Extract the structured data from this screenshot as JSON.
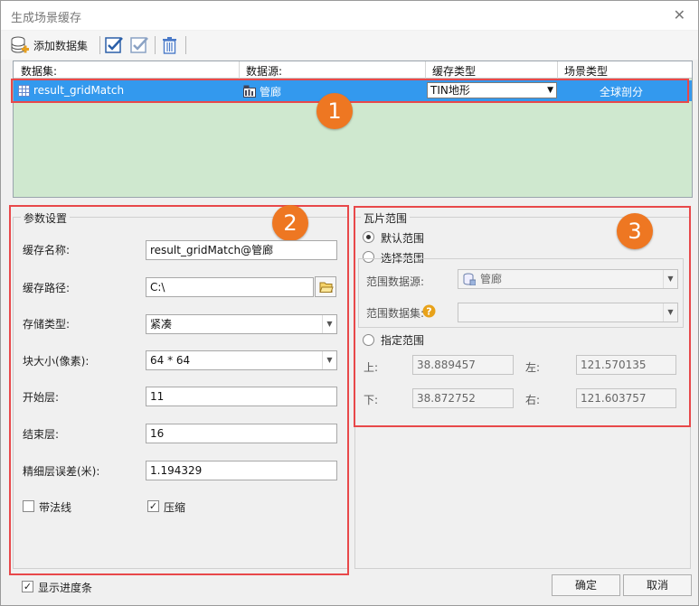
{
  "window": {
    "title": "生成场景缓存",
    "close_glyph": "✕"
  },
  "toolbar": {
    "add_dataset_label": "添加数据集"
  },
  "grid": {
    "columns": [
      "数据集:",
      "数据源:",
      "缓存类型",
      "场景类型"
    ],
    "row": {
      "dataset": "result_gridMatch",
      "datasource": "管廊",
      "cache_type": "TIN地形",
      "scene_type": "全球剖分"
    }
  },
  "badges": [
    "1",
    "2",
    "3"
  ],
  "params": {
    "legend": "参数设置",
    "cache_name_label": "缓存名称:",
    "cache_name_value": "result_gridMatch@管廊",
    "cache_path_label": "缓存路径:",
    "cache_path_value": "C:\\",
    "storage_type_label": "存储类型:",
    "storage_type_value": "紧凑",
    "block_size_label": "块大小(像素):",
    "block_size_value": "64 * 64",
    "start_level_label": "开始层:",
    "start_level_value": "11",
    "end_level_label": "结束层:",
    "end_level_value": "16",
    "fine_error_label": "精细层误差(米):",
    "fine_error_value": "1.194329",
    "normal_label": "带法线",
    "normal_checked": false,
    "compress_label": "压缩",
    "compress_checked": true
  },
  "tile_range": {
    "legend": "瓦片范围",
    "default_label": "默认范围",
    "select_label": "选择范围",
    "range_datasource_label": "范围数据源:",
    "range_datasource_value": "管廊",
    "range_dataset_label": "范围数据集:",
    "range_dataset_value": "",
    "specify_label": "指定范围",
    "top_label": "上:",
    "top_value": "38.889457",
    "left_label": "左:",
    "left_value": "121.570135",
    "bottom_label": "下:",
    "bottom_value": "38.872752",
    "right_label": "右:",
    "right_value": "121.603757"
  },
  "footer": {
    "show_progress_label": "显示进度条",
    "show_progress_checked": true,
    "ok_label": "确定",
    "cancel_label": "取消"
  },
  "colors": {
    "selection": "#3399ee",
    "grid_bg": "#cfe8cf",
    "annotation": "#e8484a",
    "badge": "#ee7722"
  }
}
